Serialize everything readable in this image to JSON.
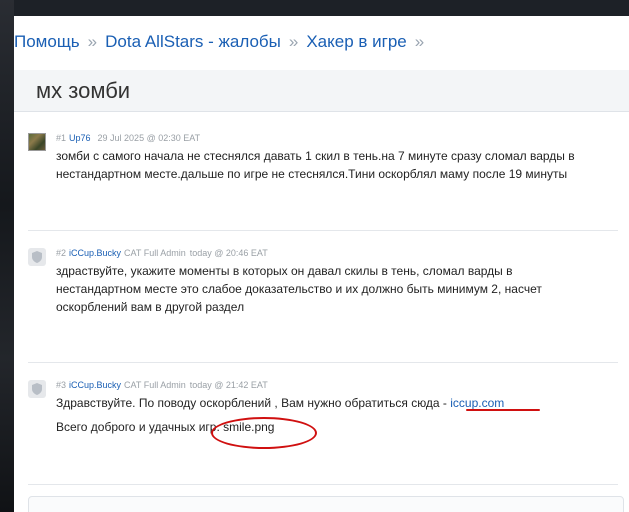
{
  "breadcrumb": {
    "items": [
      "Помощь",
      "Dota AllStars - жалобы",
      "Хакер в игре"
    ],
    "separator": "»"
  },
  "topic": {
    "title": "мх зомби"
  },
  "posts": [
    {
      "num": "#1",
      "user": "Up76",
      "role": "",
      "date": "29 Jul 2025 @ 02:30 EAT",
      "lines": [
        "зомби с самого начала не стеснялся давать 1 скил в тень.на 7 минуте сразу сломал варды в",
        "нестандартном месте.дальше по игре не стеснялся.Тини оскорблял маму после 19 минуты"
      ]
    },
    {
      "num": "#2",
      "user": "iCCup.Bucky",
      "role": "CAT Full Admin",
      "date": "today @ 20:46 EAT",
      "lines": [
        "здраствуйте, укажите моменты в которых он давал скилы в тень, сломал варды в",
        "нестандартном месте это слабое доказательство и их должно быть минимум 2, насчет",
        "оскорблений вам в другой раздел"
      ]
    },
    {
      "num": "#3",
      "user": "iCCup.Bucky",
      "role": "CAT Full Admin",
      "date": "today @ 21:42 EAT",
      "line1_prefix": "Здравствуйте. По поводу оскорблений , Вам нужно обратиться сюда - ",
      "line1_link": "iccup.com",
      "line2": "Всего доброго и удачных игр. smile.png"
    }
  ],
  "colors": {
    "link": "#1a5fb4",
    "annotation": "#d01010"
  },
  "icons": {
    "avatar_generic": "shield-icon"
  }
}
